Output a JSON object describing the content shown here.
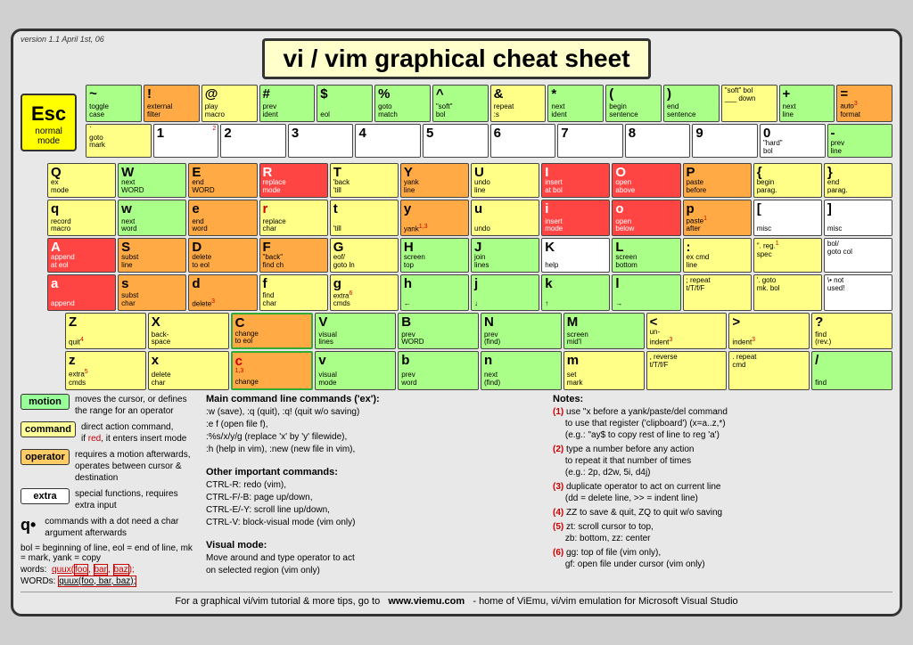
{
  "version": "version 1.1\nApril 1st, 06",
  "title": "vi / vim graphical cheat sheet",
  "esc": {
    "label": "Esc",
    "sublabel": "normal\nmode"
  },
  "footer": {
    "text": "For a graphical vi/vim tutorial & more tips, go to",
    "url": "www.viemu.com",
    "suffix": "- home of ViEmu, vi/vim emulation for Microsoft Visual Studio"
  },
  "legend": {
    "motion": {
      "label": "motion",
      "desc": "moves the cursor, or defines\nthe range for an operator"
    },
    "command": {
      "label": "command",
      "desc": "direct action command,\nif red, it enters insert mode"
    },
    "operator": {
      "label": "operator",
      "desc": "requires a motion afterwards,\noperates between cursor &\ndestination"
    },
    "extra": {
      "label": "extra",
      "desc": "special functions,\nrequires extra input"
    },
    "dot": {
      "desc": "commands with a dot need\na char argument afterwards"
    }
  },
  "bol_line": "bol = beginning of line, eol = end of line,\nmk = mark, yank = copy",
  "words_line": "words:  quux(foo, bar, baz);",
  "words_line2": "WORDs:  quux(foo, bar, baz);"
}
